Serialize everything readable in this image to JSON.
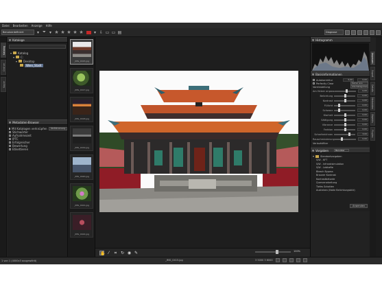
{
  "menubar": [
    "Datei",
    "Bearbeiten",
    "Anzeige",
    "Hilfe"
  ],
  "toolbar": {
    "workspace_select": "Benutzerdefiniert",
    "right_select": "Diagnose"
  },
  "left_tabs": [
    "Katalog",
    "Ordner",
    "Kopie"
  ],
  "catalog": {
    "title": "Kataloge",
    "tree": [
      {
        "label": "Katalog",
        "level": 0
      },
      {
        "label": "C:",
        "level": 1
      },
      {
        "label": "Desktop",
        "level": 2
      },
      {
        "label": "Wien_Stadt",
        "level": 3,
        "selected": true
      }
    ]
  },
  "metadata": {
    "title": "Metadaten-Browser",
    "top_item": "Mit Katalogen verknüpfen",
    "top_button": "Verfeinerung",
    "items": [
      "Stichwörter",
      "Aufnahmezeit",
      "IPTC",
      "Erfolgreicher",
      "Bewertung",
      "Etikettieren"
    ]
  },
  "filmstrip": [
    {
      "name": "_IMG_0415.jpg",
      "style": "temple",
      "selected": true
    },
    {
      "name": "_IMG_0417.jpg",
      "style": "green"
    },
    {
      "name": "_IMG_0418.jpg",
      "style": "sunset"
    },
    {
      "name": "_IMG_0419.jpg",
      "style": "dark"
    },
    {
      "name": "_IMG_0420.jpg",
      "style": "blue"
    },
    {
      "name": "_IMG_0421.jpg",
      "style": "flower"
    },
    {
      "name": "_IMG_0422.jpg",
      "style": "red"
    }
  ],
  "histogram": {
    "title": "Histogramm"
  },
  "basic": {
    "title": "Basisinformationen",
    "auto_label": "Autokorrektur",
    "auto_values": [
      "5,00",
      "0,00"
    ],
    "perfect_label": "Perfectly Clear",
    "perfect_value": "Keiner aus",
    "preset_label": "Voreinstellung",
    "preset_value": "Alle Kategorien",
    "sliders": [
      {
        "label": "Am Helzer anpassen",
        "value": "0,00",
        "pos": 0.55
      },
      {
        "label": "Belichtung",
        "value": "0,00",
        "pos": 0.5
      },
      {
        "label": "Kontrast",
        "value": "0,00",
        "pos": 0.5
      },
      {
        "label": "Füllicht",
        "value": "0,00",
        "pos": 0.2
      },
      {
        "label": "Schwarz",
        "value": "0,00",
        "pos": 0.2
      },
      {
        "label": "Klarheit",
        "value": "0,00",
        "pos": 0.5
      },
      {
        "label": "Sättigung",
        "value": "0,00",
        "pos": 0.5
      },
      {
        "label": "Vibrance",
        "value": "0,00",
        "pos": 0.5
      },
      {
        "label": "Farbton",
        "value": "0,00",
        "pos": 0.5
      },
      {
        "label": "Scharfzeichnen",
        "value": "3,00",
        "pos": 0.7
      },
      {
        "label": "Rauschminderung",
        "value": "0,00",
        "pos": 0.3
      }
    ],
    "gradient_label": "Verlaufsfilter"
  },
  "presets": {
    "title": "Vorgaben",
    "drop": "Benutzer",
    "group": "Standardvorgaben",
    "items": [
      "S/W - KFT",
      "S/W - Infrarotsimulation",
      "S/W - Lebhafte",
      "Bleach Bypass",
      "Brauner Kontrast",
      "Kontrastbetonte",
      "Querverarbeitung",
      "Tiefes Schatten",
      "Ausheben (Natie Belichtungsbild)"
    ],
    "apply_button": "Anwenden"
  },
  "right_tabs": [
    "Anpassen",
    "Export",
    "Details",
    "Metadaten",
    "Objektiv",
    "Plugins"
  ],
  "statusbar": {
    "left": "1 von 1 (4000x3 ausgewählt)",
    "mid": "_IMG_0415.jpg",
    "right": "3 5000 3 6000"
  },
  "zoom": "100%"
}
